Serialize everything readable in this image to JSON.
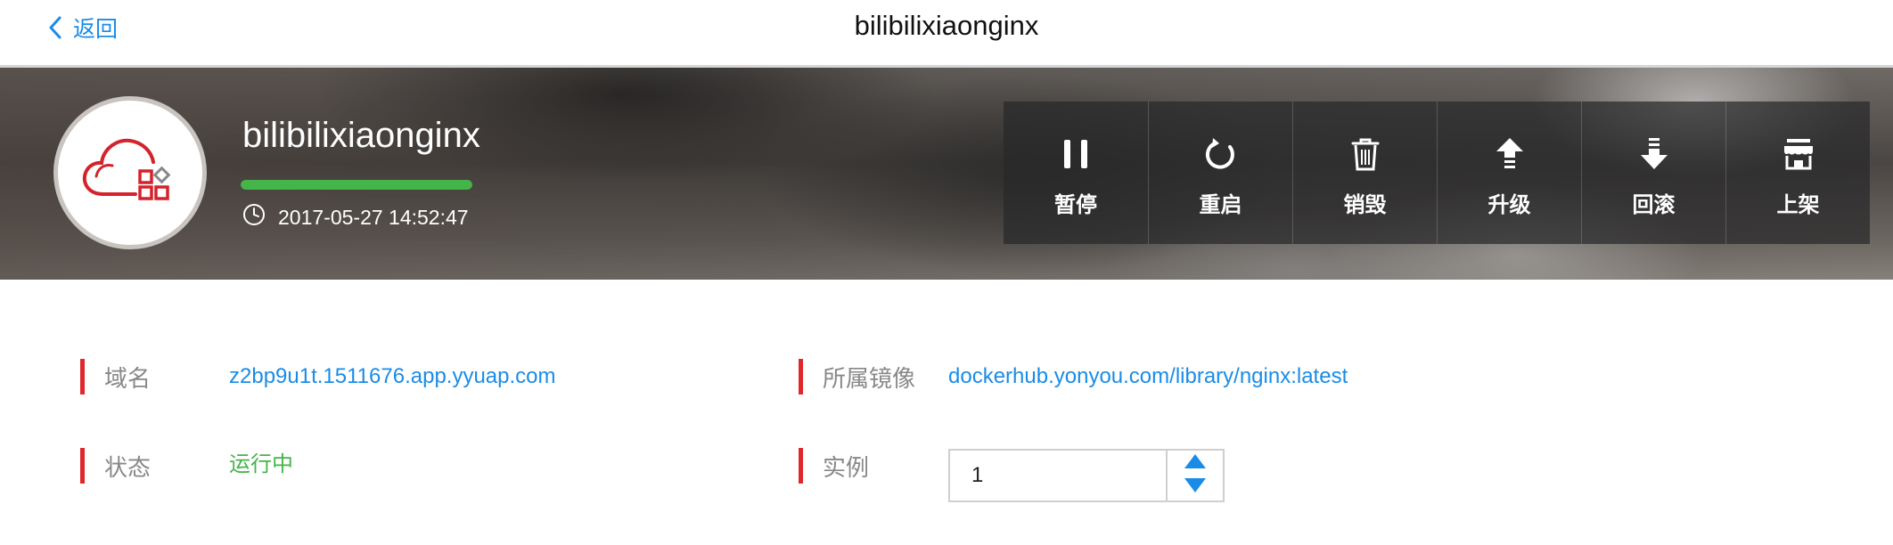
{
  "nav": {
    "back_label": "返回",
    "title": "bilibilixiaonginx"
  },
  "app": {
    "name": "bilibilixiaonginx",
    "progress_percent": 100,
    "created_time": "2017-05-27 14:52:47"
  },
  "actions": [
    {
      "label": "暂停",
      "icon": "pause-icon"
    },
    {
      "label": "重启",
      "icon": "restart-icon"
    },
    {
      "label": "销毁",
      "icon": "trash-icon"
    },
    {
      "label": "升级",
      "icon": "upgrade-icon"
    },
    {
      "label": "回滚",
      "icon": "rollback-icon"
    },
    {
      "label": "上架",
      "icon": "store-icon"
    }
  ],
  "details": {
    "domain": {
      "label": "域名",
      "value": "z2bp9u1t.1511676.app.yyuap.com"
    },
    "status": {
      "label": "状态",
      "value": "运行中"
    },
    "image": {
      "label": "所属镜像",
      "value": "dockerhub.yonyou.com/library/nginx:latest"
    },
    "instances": {
      "label": "实例",
      "value": "1"
    }
  },
  "colors": {
    "accent_blue": "#1a8ce8",
    "status_green": "#44b549",
    "marker_red": "#e0282b",
    "logo_red": "#d4232c"
  }
}
